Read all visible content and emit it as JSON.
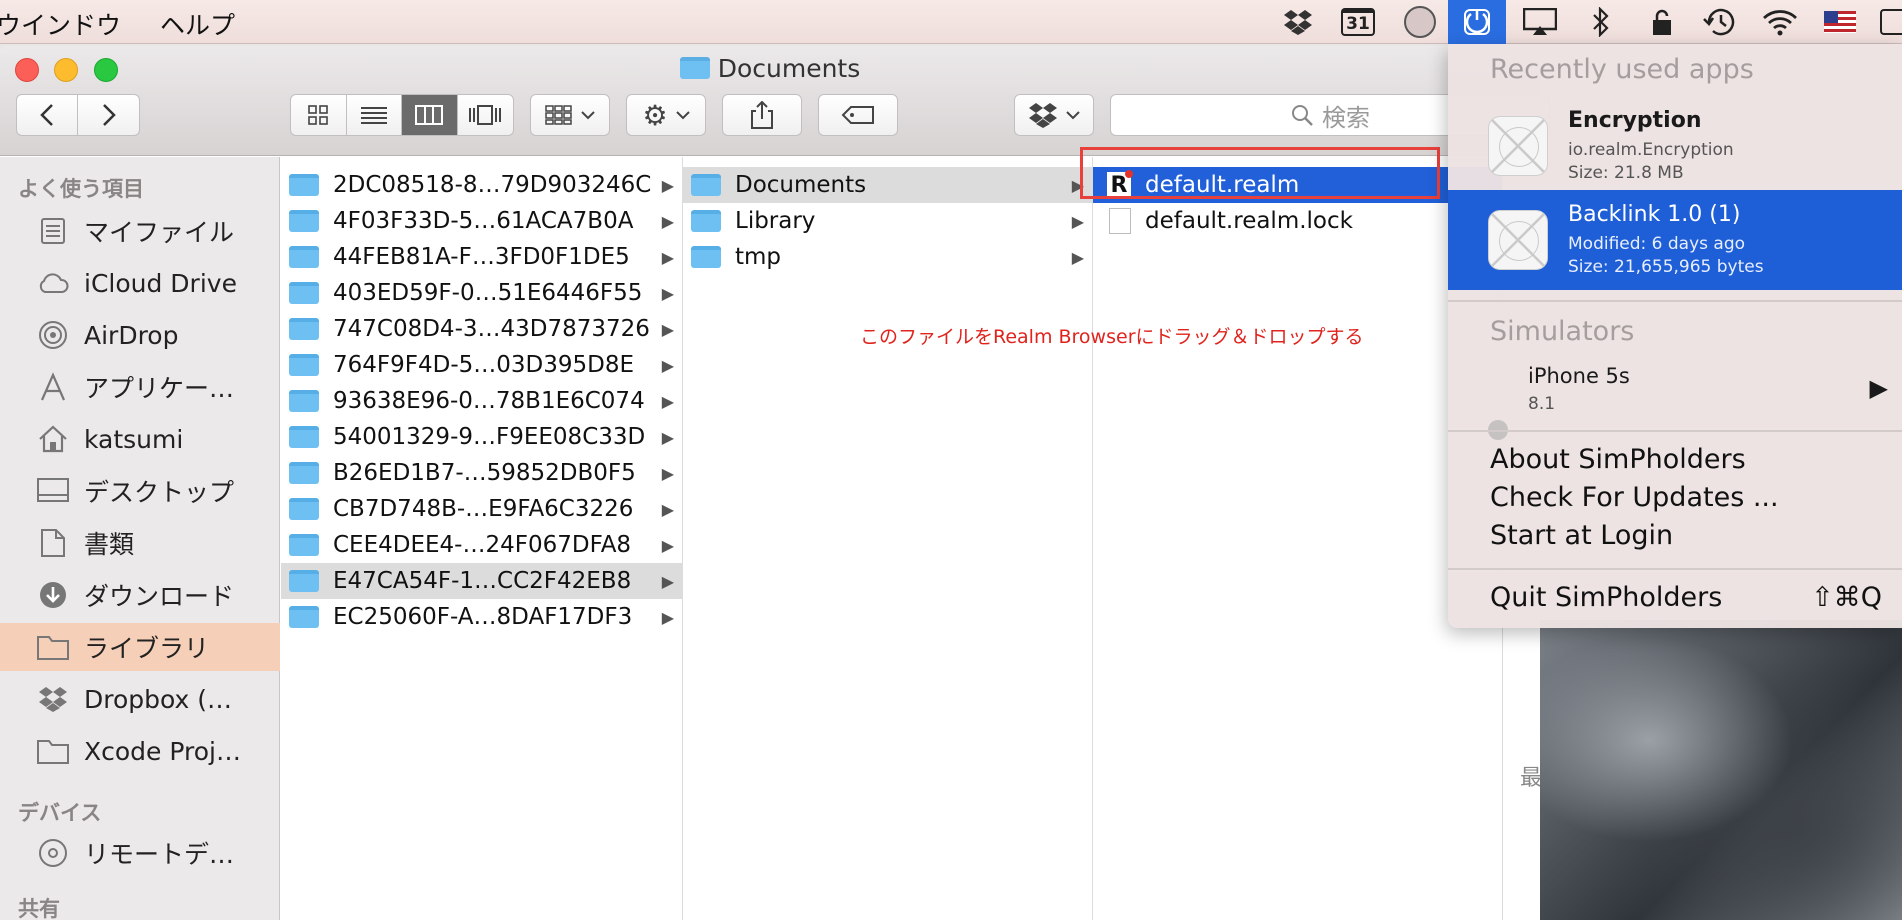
{
  "menubar": {
    "left_items": [
      "ウインドウ",
      "ヘルプ"
    ],
    "calendar_day": "31",
    "icons": [
      "dropbox-icon",
      "calendar-icon",
      "circle-icon",
      "simpholders-icon",
      "airplay-icon",
      "bluetooth-icon",
      "lock-icon",
      "time-machine-icon",
      "wifi-icon",
      "flag-icon"
    ]
  },
  "window": {
    "title": "Documents",
    "search_placeholder": "検索"
  },
  "sidebar": {
    "favorites_heading": "よく使う項目",
    "items": [
      {
        "label": "マイファイル",
        "icon": "all-files-icon"
      },
      {
        "label": "iCloud Drive",
        "icon": "cloud-icon"
      },
      {
        "label": "AirDrop",
        "icon": "airdrop-icon"
      },
      {
        "label": "アプリケー…",
        "icon": "applications-icon"
      },
      {
        "label": "katsumi",
        "icon": "home-icon"
      },
      {
        "label": "デスクトップ",
        "icon": "desktop-icon"
      },
      {
        "label": "書類",
        "icon": "documents-icon"
      },
      {
        "label": "ダウンロード",
        "icon": "downloads-icon"
      },
      {
        "label": "ライブラリ",
        "icon": "folder-icon"
      },
      {
        "label": "Dropbox (…",
        "icon": "dropbox-icon"
      },
      {
        "label": "Xcode Proj…",
        "icon": "folder-icon"
      }
    ],
    "devices_heading": "デバイス",
    "devices": [
      {
        "label": "リモートデ…",
        "icon": "disc-icon"
      }
    ],
    "shared_heading": "共有"
  },
  "columns": {
    "col1": [
      "2DC08518-8…79D903246C",
      "4F03F33D-5…61ACA7B0A",
      "44FEB81A-F…3FD0F1DE5",
      "403ED59F-0…51E6446F55",
      "747C08D4-3…43D7873726",
      "764F9F4D-5…03D395D8E",
      "93638E96-0…78B1E6C074",
      "54001329-9…F9EE08C33D",
      "B26ED1B7-…59852DB0F5",
      "CB7D748B-…E9FA6C3226",
      "CEE4DEE4-…24F067DFA8",
      "E47CA54F-1…CC2F42EB8",
      "EC25060F-A…8DAF17DF3"
    ],
    "col2": [
      "Documents",
      "Library",
      "tmp"
    ],
    "col3": [
      "default.realm",
      "default.realm.lock"
    ]
  },
  "annotation": "このファイルをRealm Browserにドラッグ＆ドロップする",
  "dropdown": {
    "recent_heading": "Recently used apps",
    "apps": [
      {
        "name": "Encryption",
        "line1": "io.realm.Encryption",
        "line2": "Size: 21.8 MB"
      },
      {
        "name": "Backlink 1.0 (1)",
        "line1": "Modified: 6 days ago",
        "line2": "Size: 21,655,965 bytes"
      }
    ],
    "simulators_heading": "Simulators",
    "simulator": {
      "name": "iPhone 5s",
      "version": "8.1"
    },
    "about": "About SimPholders",
    "updates": "Check For Updates ...",
    "login": "Start at Login",
    "quit": "Quit SimPholders",
    "quit_shortcut": "⇧⌘Q"
  },
  "desktop_partial_char": "最"
}
